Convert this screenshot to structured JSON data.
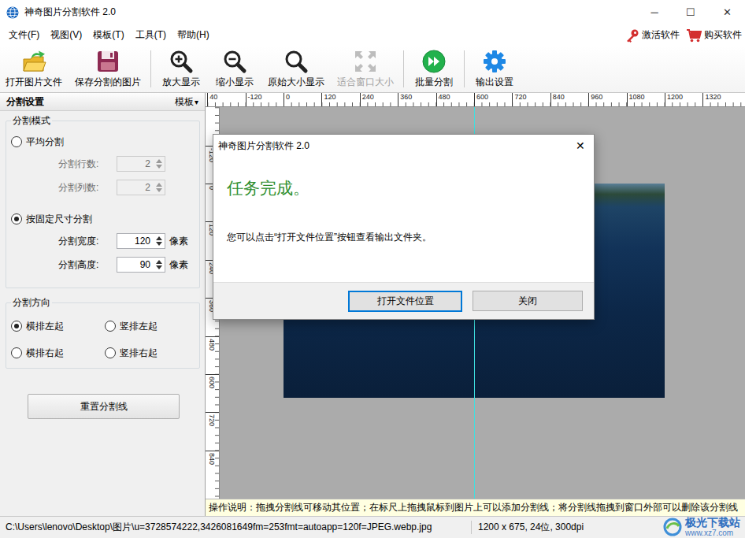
{
  "window": {
    "title": "神奇图片分割软件 2.0",
    "controls": [
      "─",
      "☐",
      "✕"
    ]
  },
  "menu": {
    "items": [
      "文件(F)",
      "视图(V)",
      "模板(T)",
      "工具(T)",
      "帮助(H)"
    ],
    "actions": [
      "激活软件",
      "购买软件"
    ]
  },
  "toolbar": [
    {
      "items": [
        {
          "label": "打开图片文件",
          "disabled": false
        },
        {
          "label": "保存分割的图片",
          "disabled": false
        }
      ]
    },
    {
      "items": [
        {
          "label": "放大显示",
          "disabled": false
        },
        {
          "label": "缩小显示",
          "disabled": false
        },
        {
          "label": "原始大小显示",
          "disabled": false
        },
        {
          "label": "适合窗口大小",
          "disabled": true
        }
      ]
    },
    {
      "items": [
        {
          "label": "批量分割",
          "disabled": false
        }
      ]
    },
    {
      "items": [
        {
          "label": "输出设置",
          "disabled": false
        }
      ]
    }
  ],
  "panel": {
    "title": "分割设置",
    "template_menu": {
      "label": "模板",
      "arrow": "▾"
    },
    "mode_group": {
      "title": "分割模式",
      "options": [
        {
          "label": "平均分割",
          "selected": false,
          "fields": [
            {
              "label": "分割行数:",
              "value": "2",
              "unit": "",
              "disabled": true
            },
            {
              "label": "分割列数:",
              "value": "2",
              "unit": "",
              "disabled": true
            }
          ]
        },
        {
          "label": "按固定尺寸分割",
          "selected": true,
          "fields": [
            {
              "label": "分割宽度:",
              "value": "120",
              "unit": "像素",
              "disabled": false
            },
            {
              "label": "分割高度:",
              "value": "90",
              "unit": "像素",
              "disabled": false
            }
          ]
        }
      ]
    },
    "direction_group": {
      "title": "分割方向",
      "options": [
        {
          "label": "横排左起",
          "selected": true
        },
        {
          "label": "竖排左起",
          "selected": false
        },
        {
          "label": "横排右起",
          "selected": false
        },
        {
          "label": "竖排右起",
          "selected": false
        }
      ]
    },
    "reset_button": "重置分割线"
  },
  "ruler": {
    "horizontal": [
      "40",
      "-120",
      "0",
      "120",
      "240",
      "360",
      "480",
      "600",
      "720",
      "840",
      "960",
      "1080",
      "1200",
      "1320"
    ],
    "vertical": [
      "-120",
      "0",
      "120",
      "240",
      "360",
      "480",
      "600",
      "720",
      "840"
    ]
  },
  "hint": "操作说明：拖拽分割线可移动其位置；在标尺上拖拽鼠标到图片上可以添加分割线；将分割线拖拽到窗口外部可以删除该分割线",
  "status_bar": {
    "path": "C:\\Users\\lenovo\\Desktop\\图片\\u=3728574222,3426081649fm=253fmt=autoapp=120f=JPEG.webp.jpg",
    "info": "1200 x 675, 24位, 300dpi"
  },
  "dialog": {
    "title": "神奇图片分割软件 2.0",
    "close": "✕",
    "heading": "任务完成。",
    "message": "您可以点击“打开文件位置”按钮查看输出文件夹。",
    "buttons": [
      {
        "label": "打开文件位置",
        "focused": true
      },
      {
        "label": "关闭",
        "focused": false
      }
    ]
  },
  "watermark": {
    "name": "极光下载站",
    "url": "www.xz7.com"
  }
}
